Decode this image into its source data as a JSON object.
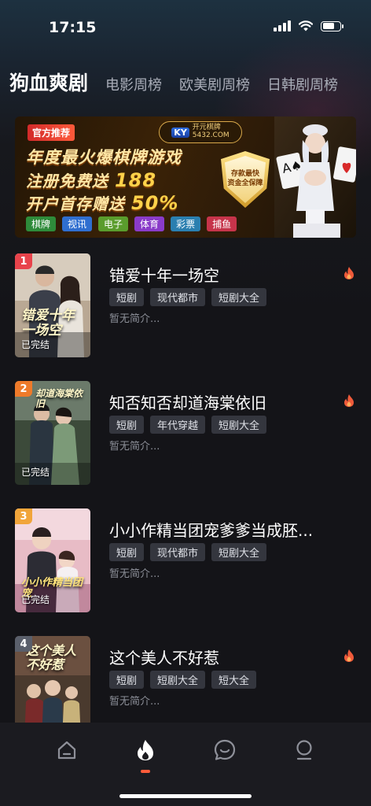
{
  "status_bar": {
    "time": "17:15"
  },
  "tabs": [
    {
      "label": "狗血爽剧",
      "active": true
    },
    {
      "label": "电影周榜",
      "active": false
    },
    {
      "label": "欧美剧周榜",
      "active": false
    },
    {
      "label": "日韩剧周榜",
      "active": false
    }
  ],
  "banner": {
    "tag": "官方推荐",
    "logo_badge": "KY",
    "logo_name": "开元棋牌",
    "logo_url_text": "5432.COM",
    "line1": "年度最火爆棋牌游戏",
    "line2_text": "注册免费送",
    "line2_num": "188",
    "line3_text": "开户首存赠送",
    "line3_num": "50%",
    "shield_line1": "存款最快",
    "shield_line2": "资金全保障",
    "chips": [
      "棋牌",
      "视讯",
      "电子",
      "体育",
      "彩票",
      "捕鱼"
    ]
  },
  "dramas": [
    {
      "rank": "1",
      "title": "错爱十年一场空",
      "poster_title": "错爱十年一场空",
      "status": "已完结",
      "tags": [
        "短剧",
        "现代都市",
        "短剧大全"
      ],
      "description": "暂无简介..."
    },
    {
      "rank": "2",
      "title": "知否知否却道海棠依旧",
      "poster_title": "却道海棠依旧",
      "status": "已完结",
      "tags": [
        "短剧",
        "年代穿越",
        "短剧大全"
      ],
      "description": "暂无简介..."
    },
    {
      "rank": "3",
      "title": "小小作精当团宠爹爹当成胚...",
      "poster_title": "小小作精当团宠",
      "status": "已完结",
      "tags": [
        "短剧",
        "现代都市",
        "短剧大全"
      ],
      "description": "暂无简介..."
    },
    {
      "rank": "4",
      "title": "这个美人不好惹",
      "poster_title": "这个美人不好惹",
      "status": "",
      "tags": [
        "短剧",
        "短剧大全",
        "短大全"
      ],
      "description": "暂无简介..."
    }
  ],
  "bottom_nav": [
    {
      "icon": "home-icon",
      "active": false
    },
    {
      "icon": "fire-icon",
      "active": true
    },
    {
      "icon": "chat-icon",
      "active": false
    },
    {
      "icon": "profile-icon",
      "active": false
    }
  ],
  "colors": {
    "accent": "#ff5c3a",
    "background": "#141418",
    "tag_bg": "#34363e"
  }
}
